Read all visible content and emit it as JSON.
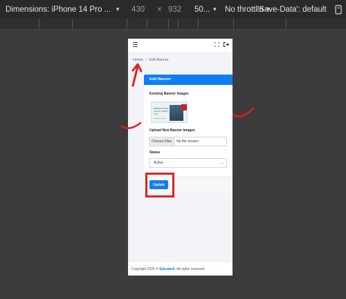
{
  "devtools": {
    "dimensions": "Dimensions: iPhone 14 Pro ...",
    "width": "430",
    "times": "×",
    "height": "932",
    "zoom": "50...",
    "throttling": "No throttlin",
    "save_data": "'Save-Data': default"
  },
  "app": {
    "breadcrumb": {
      "home": "Home",
      "separator": "/",
      "current": "Edit Banner"
    },
    "card": {
      "title": "Edit Banner",
      "existing_label": "Existing Banner Images",
      "thumb_text": "Palliative & End-of-Life Comfort Care",
      "upload_label": "Upload New Banner Images",
      "choose_files": "Choose Files",
      "no_file": "No file chosen",
      "status_label": "Status",
      "status_value": "Active",
      "update_button": "Update"
    },
    "footer": {
      "prefix": "Copyright 2026 ©",
      "brand": "Edustack",
      "suffix": ". All rights reserved."
    }
  },
  "colors": {
    "accent": "#0d7ef6",
    "annotation": "#e02020",
    "devtools_bg": "#2a2a2a"
  },
  "icons": [
    "menu-icon",
    "expand-icon",
    "logout-icon",
    "chevron-down-icon",
    "rotate-icon"
  ]
}
